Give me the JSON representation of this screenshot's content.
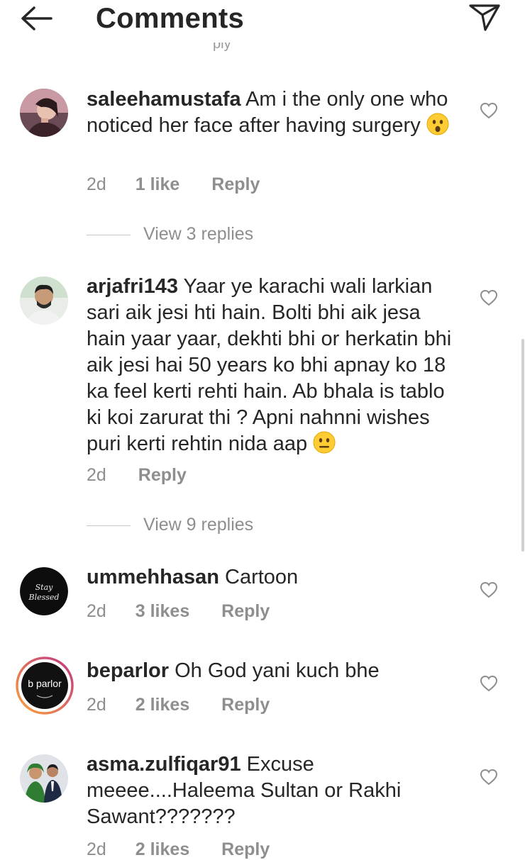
{
  "header": {
    "title": "Comments"
  },
  "top_cut_text": "ply",
  "comments": [
    {
      "username": "saleehamustafa",
      "text": "Am i the only one who noticed her face after having surgery",
      "emoji": "astonished-face",
      "time": "2d",
      "likes": "1 like",
      "reply": "Reply",
      "view_replies": "View 3 replies"
    },
    {
      "username": "arjafri143",
      "text": "Yaar ye karachi wali larkian sari aik jesi hti hain. Bolti bhi aik jesa hain yaar yaar, dekhti bhi or herkatin bhi aik jesi hai 50 years ko bhi apnay ko 18 ka feel kerti rehti hain. Ab bhala is tablo ki koi zarurat thi ? Apni nahnni wishes puri kerti rehtin nida aap",
      "emoji": "neutral-face",
      "time": "2d",
      "likes": "",
      "reply": "Reply",
      "view_replies": "View 9 replies"
    },
    {
      "username": "ummehhasan",
      "text": "Cartoon",
      "avatar_text_1": "Stay",
      "avatar_text_2": "Blessed",
      "time": "2d",
      "likes": "3 likes",
      "reply": "Reply"
    },
    {
      "username": "beparlor",
      "text": "Oh God yani kuch bhe",
      "avatar_text": "b parlor",
      "time": "2d",
      "likes": "2 likes",
      "reply": "Reply"
    },
    {
      "username": "asma.zulfiqar91",
      "text": "Excuse meeee....Haleema Sultan or Rakhi Sawant???????",
      "time": "2d",
      "likes": "2 likes",
      "reply": "Reply"
    }
  ],
  "colors": {
    "text": "#262626",
    "secondary": "#8e8e8e",
    "story_ring_start": "#f9a23a",
    "story_ring_end": "#c13584"
  }
}
